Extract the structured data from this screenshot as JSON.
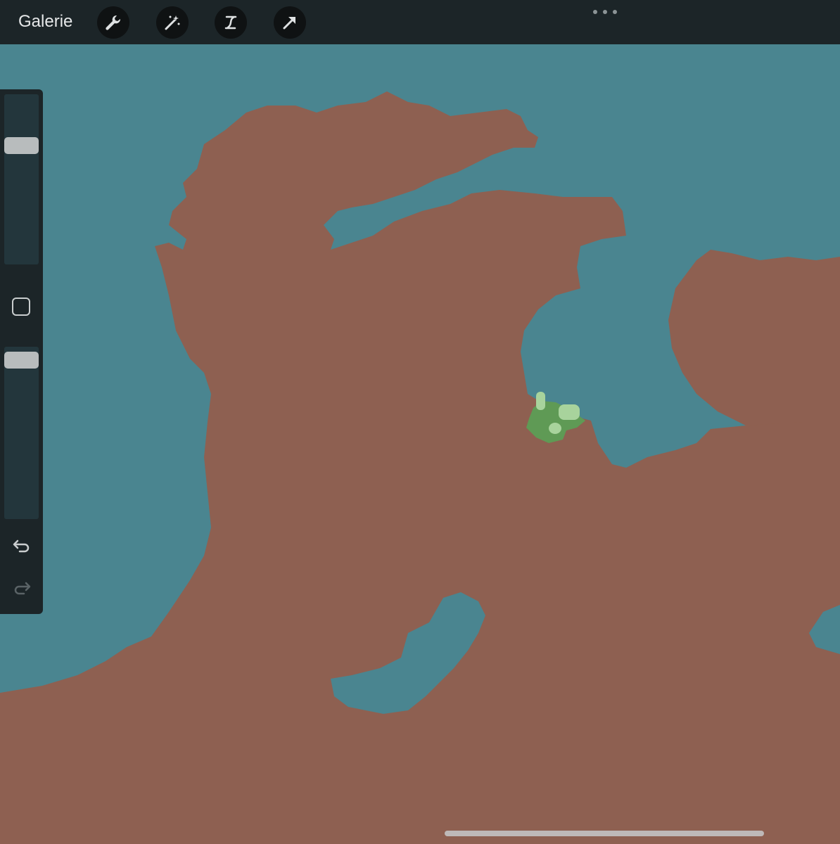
{
  "toolbar": {
    "gallery_label": "Galerie"
  },
  "colors": {
    "water": "#4a8590",
    "land": "#8e6051",
    "vegetation": "#5f9a55",
    "vegetation_highlight": "#a8d39c",
    "toolbar_bg": "#1c2528"
  },
  "icons": [
    "wrench-icon",
    "magic-wand-icon",
    "selection-icon",
    "transform-arrow-icon",
    "more-icon",
    "square-modifier-icon",
    "undo-icon",
    "redo-icon"
  ],
  "sidebar": {
    "brush_size_level": 0.72,
    "opacity_level": 0.97
  }
}
